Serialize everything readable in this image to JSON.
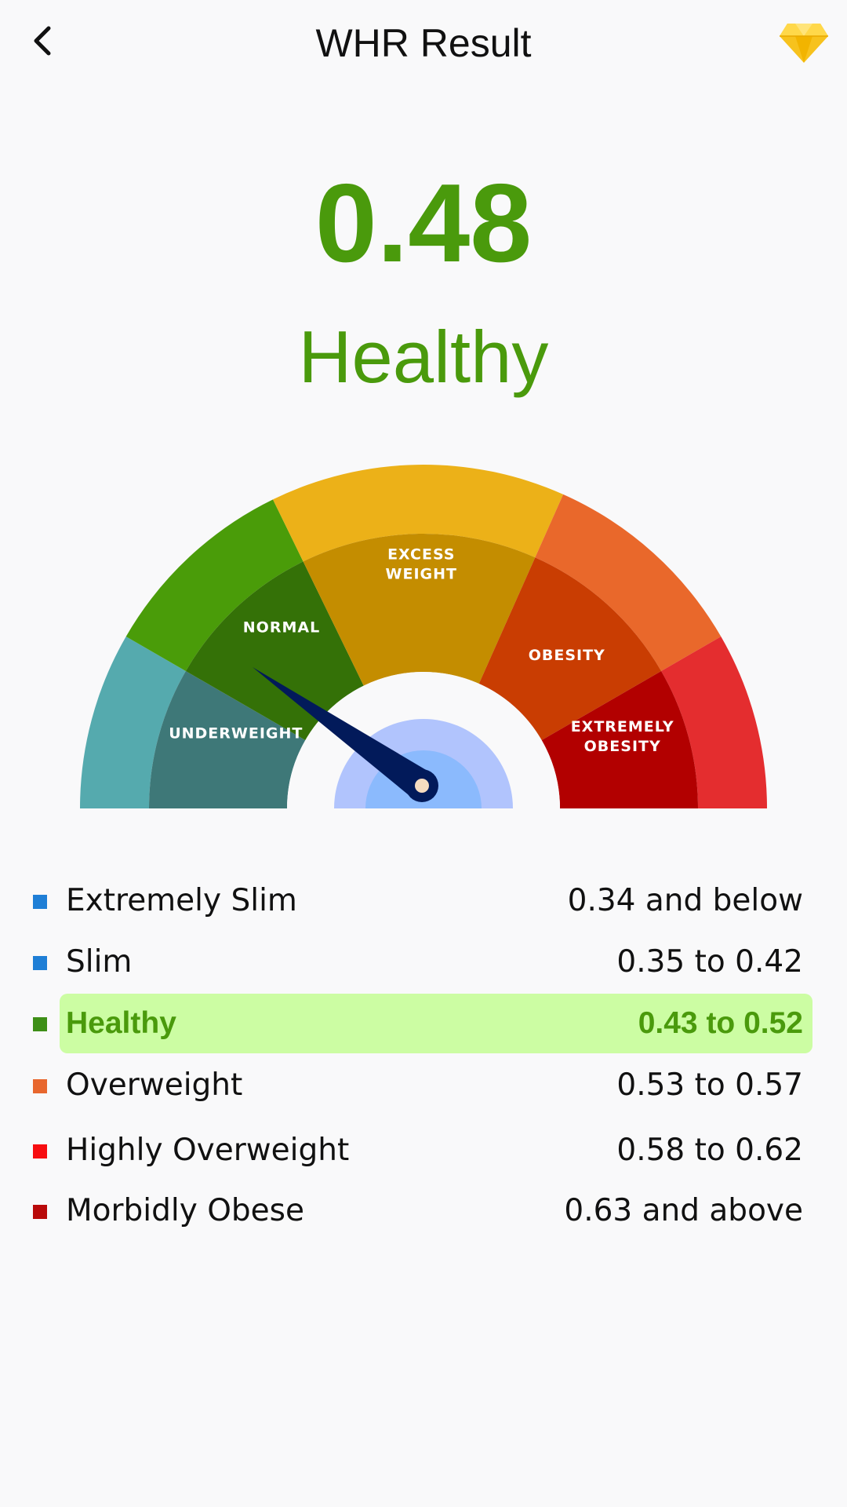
{
  "header": {
    "title": "WHR Result",
    "back_icon": "chevron-left-icon",
    "premium_icon": "diamond-icon"
  },
  "result": {
    "value": "0.48",
    "status": "Healthy",
    "color": "#4a9a0c"
  },
  "gauge": {
    "segments": [
      {
        "label": "UNDERWEIGHT",
        "outer_color": "#55aaae",
        "inner_color": "#3e7878"
      },
      {
        "label": "NORMAL",
        "outer_color": "#4a9c09",
        "inner_color": "#347107"
      },
      {
        "label_lines": [
          "EXCESS",
          "WEIGHT"
        ],
        "outer_color": "#ecb118",
        "inner_color": "#c48d00"
      },
      {
        "label": "OBESITY",
        "outer_color": "#e9682b",
        "inner_color": "#c93d02"
      },
      {
        "label_lines": [
          "EXTREMELY",
          "OBESITY"
        ],
        "outer_color": "#e42d2f",
        "inner_color": "#b20000"
      }
    ],
    "needle_color": "#021a5a",
    "hub_outer_color": "#b1c4fd",
    "hub_inner_color": "#8bbafd"
  },
  "legend": [
    {
      "name": "Extremely Slim",
      "range": "0.34 and below",
      "color": "#1f7fd6",
      "active": false
    },
    {
      "name": "Slim",
      "range": "0.35 to 0.42",
      "color": "#1f7fd6",
      "active": false
    },
    {
      "name": "Healthy",
      "range": "0.43 to 0.52",
      "color": "#3e8f17",
      "active": true
    },
    {
      "name": "Overweight",
      "range": "0.53 to 0.57",
      "color": "#e8672e",
      "active": false
    },
    {
      "name": "Highly Overweight",
      "range": "0.58 to 0.62",
      "color": "#f70d10",
      "active": false
    },
    {
      "name": "Morbidly Obese",
      "range": "0.63 and above",
      "color": "#b90a0a",
      "active": false
    }
  ]
}
